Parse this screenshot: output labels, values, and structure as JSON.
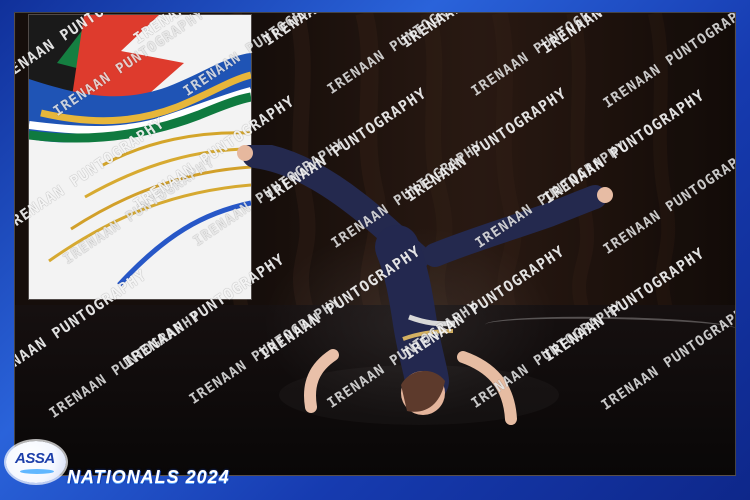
{
  "event": {
    "title": "NATIONALS 2024"
  },
  "logo": {
    "text": "ASSA"
  },
  "watermark": {
    "text": "IRENAAN PUNTOGRAPHY"
  },
  "colors": {
    "frame_blue": "#1f4fcb",
    "frame_light_blue": "#58a8ff",
    "stage_black": "#090707",
    "curtain_brown": "#2a1a13",
    "dancer_navy": "#23284f"
  }
}
